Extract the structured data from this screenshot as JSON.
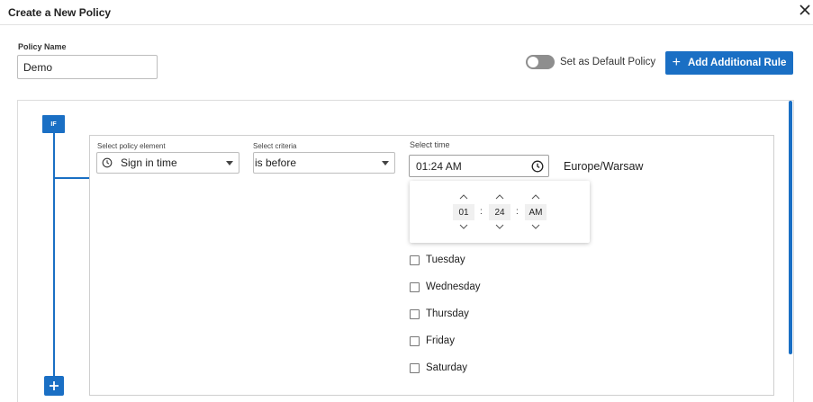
{
  "dialog": {
    "title": "Create a New Policy"
  },
  "policy": {
    "name_label": "Policy Name",
    "name_value": "Demo",
    "default_toggle_label": "Set as Default Policy",
    "add_rule_label": "Add Additional Rule"
  },
  "rule": {
    "if_label": "IF",
    "element": {
      "label": "Select policy element",
      "value": "Sign in time"
    },
    "criteria": {
      "label": "Select criteria",
      "value": "is before"
    },
    "time": {
      "label": "Select time",
      "value": "01:24 AM",
      "timezone": "Europe/Warsaw",
      "hour": "01",
      "minute": "24",
      "period": "AM",
      "separator": ":"
    },
    "days": [
      {
        "label": "Tuesday",
        "checked": false
      },
      {
        "label": "Wednesday",
        "checked": false
      },
      {
        "label": "Thursday",
        "checked": false
      },
      {
        "label": "Friday",
        "checked": false
      },
      {
        "label": "Saturday",
        "checked": false
      }
    ]
  },
  "colors": {
    "accent": "#1a6fc4",
    "toggle_off": "#8e8e8e"
  },
  "icons": [
    "close-icon",
    "plus-icon",
    "clock-icon",
    "chevron-up-icon",
    "chevron-down-icon"
  ]
}
